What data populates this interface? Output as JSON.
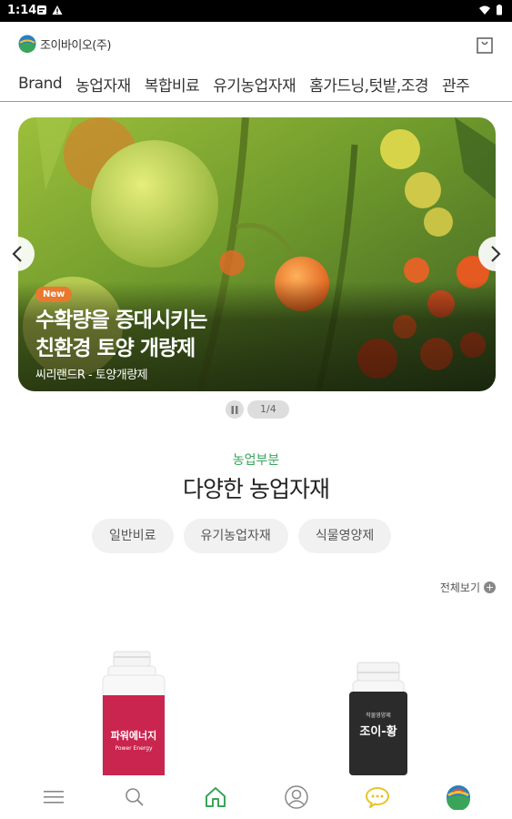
{
  "status": {
    "time": "1:14"
  },
  "header": {
    "brand": "조이바이오(주)"
  },
  "tabs": [
    "Brand",
    "농업자재",
    "복합비료",
    "유기농업자재",
    "홈가드닝,텃밭,조경",
    "관주"
  ],
  "slide": {
    "badge": "New",
    "title_line1": "수확량을 증대시키는",
    "title_line2": "친환경 토양 개량제",
    "subtitle": "씨리랜드R - 토양개량제",
    "counter": "1/4"
  },
  "section": {
    "eyebrow": "농업부분",
    "title": "다양한 농업자재",
    "chips": [
      "일반비료",
      "유기농업자재",
      "식물영양제"
    ],
    "view_all": "전체보기"
  },
  "products": [
    {
      "label": "파워에너지",
      "sub": "Power Energy",
      "color": "#c9254f"
    },
    {
      "label": "조이-황",
      "sub": "작물영양제",
      "color": "#2b2b2b"
    }
  ],
  "colors": {
    "accent": "#6cc04a",
    "brand_green": "#3aa55a",
    "new_badge": "#e8792e"
  }
}
